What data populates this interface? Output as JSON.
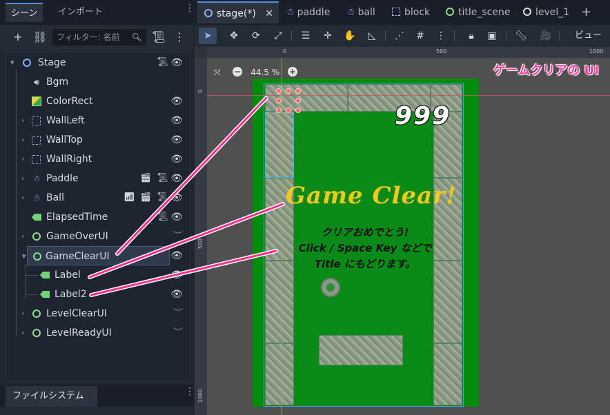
{
  "dock": {
    "tabs": [
      "シーン",
      "インポート"
    ],
    "filter_placeholder": "フィルター: 名前"
  },
  "tree": [
    {
      "label": "Stage",
      "icon": "node2d-icon",
      "expanded": true
    },
    {
      "label": "Bgm",
      "icon": "audio-icon"
    },
    {
      "label": "ColorRect",
      "icon": "colorrect-icon"
    },
    {
      "label": "WallLeft",
      "icon": "static-body-icon"
    },
    {
      "label": "WallTop",
      "icon": "static-body-icon"
    },
    {
      "label": "WallRight",
      "icon": "static-body-icon"
    },
    {
      "label": "Paddle",
      "icon": "character-body-icon"
    },
    {
      "label": "Ball",
      "icon": "character-body-icon"
    },
    {
      "label": "ElapsedTime",
      "icon": "label-icon"
    },
    {
      "label": "GameOverUI",
      "icon": "canvas-layer-icon"
    },
    {
      "label": "GameClearUI",
      "icon": "canvas-layer-icon",
      "selected": true
    },
    {
      "label": "Label",
      "icon": "label-icon"
    },
    {
      "label": "Label2",
      "icon": "label-icon"
    },
    {
      "label": "LevelClearUI",
      "icon": "canvas-layer-icon"
    },
    {
      "label": "LevelReadyUI",
      "icon": "canvas-layer-icon"
    }
  ],
  "filesystem_tab": "ファイルシステム",
  "editor_tabs": [
    "stage(*)",
    "paddle",
    "ball",
    "block",
    "title_scene",
    "level_1"
  ],
  "view_menu": "ビュー",
  "zoom": "44.5 %",
  "ruler": {
    "top": [
      "0",
      "500",
      "1000"
    ],
    "left": [
      "0",
      "500",
      "1000"
    ]
  },
  "banner": "ゲームクリアの UI",
  "game": {
    "score": "999",
    "title": "Game Clear!",
    "message_lines": [
      "クリアおめでとう!",
      "Click / Space Key などで",
      "Title にもどります。"
    ]
  }
}
